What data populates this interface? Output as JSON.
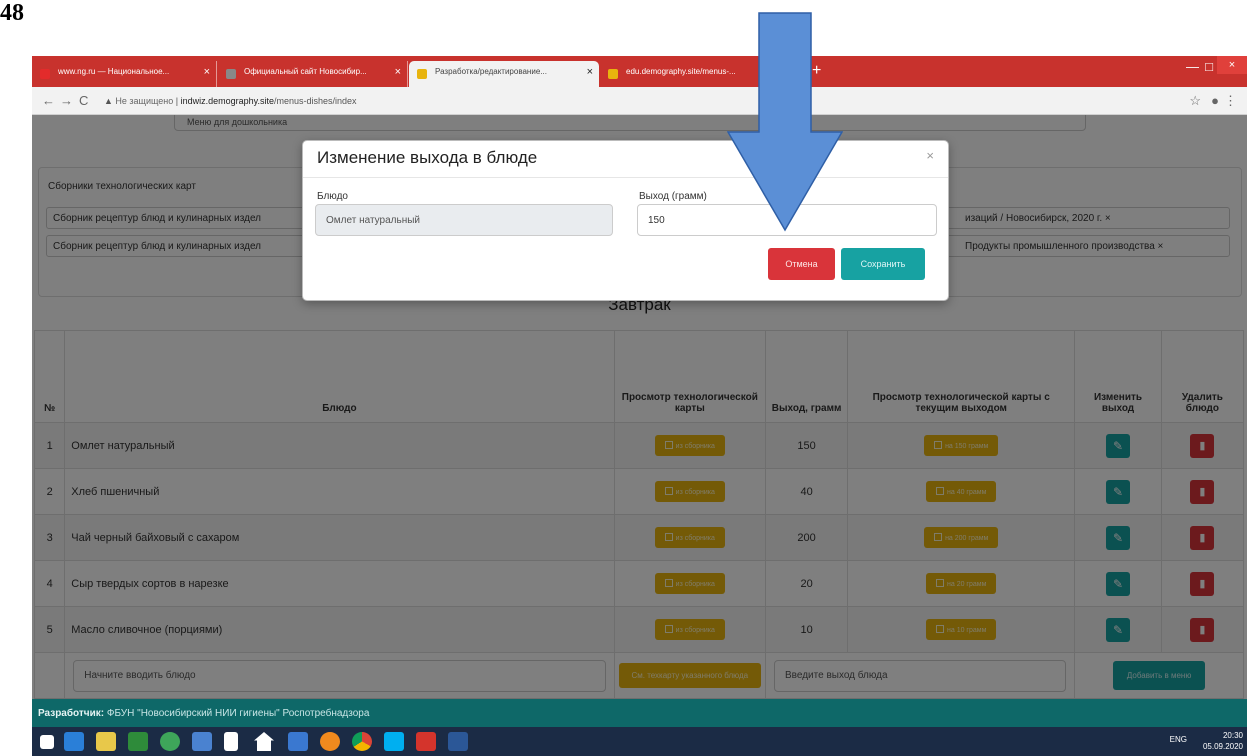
{
  "figure_label": "48",
  "browser": {
    "tabs": [
      {
        "title": "www.ng.ru — Национальное...",
        "favicon_color": "#e32b2b",
        "active": false
      },
      {
        "title": "Официальный сайт Новосибир...",
        "favicon_color": "#888888",
        "active": false
      },
      {
        "title": "Разработка/редактирование...",
        "favicon_color": "#e8b40e",
        "active": true
      },
      {
        "title": "edu.demography.site/menus-...",
        "favicon_color": "#e8b40e",
        "active": false
      }
    ],
    "new_tab": "+",
    "nav": {
      "back": "←",
      "forward": "→",
      "reload": "C"
    },
    "url_warning": "Не защищено",
    "url_host": "indwiz.demography.site",
    "url_path": "/menus-dishes/index",
    "window": {
      "minimize": "—",
      "maximize": "□",
      "close": "×"
    }
  },
  "page": {
    "menu_select": "Меню для дошкольника",
    "collections_label": "Сборники технологических карт",
    "collection_tags": [
      {
        "left": "Сборник рецептур блюд и кулинарных издел",
        "right": "изаций / Новосибирск, 2020 г. ×"
      },
      {
        "left": "Сборник рецептур блюд и кулинарных издел",
        "right": "Продукты промышленного производства ×"
      }
    ],
    "section_title": "Завтрак",
    "table": {
      "headers": {
        "num": "№",
        "dish": "Блюдо",
        "view_card": "Просмотр технологической карты",
        "yield": "Выход, грамм",
        "view_card_yield": "Просмотр технологической карты с текущим выходом",
        "edit": "Изменить выход",
        "delete": "Удалить блюдо"
      },
      "rows": [
        {
          "n": "1",
          "dish": "Омлет натуральный",
          "card_btn": "из сборника",
          "yield": "150",
          "yield_btn": "на 150 грамм"
        },
        {
          "n": "2",
          "dish": "Хлеб пшеничный",
          "card_btn": "из сборника",
          "yield": "40",
          "yield_btn": "на 40 грамм"
        },
        {
          "n": "3",
          "dish": "Чай черный байховый с сахаром",
          "card_btn": "из сборника",
          "yield": "200",
          "yield_btn": "на 200 грамм"
        },
        {
          "n": "4",
          "dish": "Сыр твердых сортов в нарезке",
          "card_btn": "из сборника",
          "yield": "20",
          "yield_btn": "на 20 грамм"
        },
        {
          "n": "5",
          "dish": "Масло сливочное (порциями)",
          "card_btn": "из сборника",
          "yield": "10",
          "yield_btn": "на 10 грамм"
        }
      ],
      "add_row": {
        "dish_placeholder": "Начните вводить блюдо",
        "card_btn": "См. техкарту указанного блюда",
        "yield_placeholder": "Введите выход блюда",
        "add_btn": "Добавить в меню"
      }
    },
    "footer": {
      "label": "Разработчик:",
      "text": "ФБУН \"Новосибирский НИИ гигиены\" Роспотребнадзора"
    }
  },
  "modal": {
    "title": "Изменение выхода в блюде",
    "close": "×",
    "dish_label": "Блюдо",
    "dish_value": "Омлет натуральный",
    "yield_label": "Выход (грамм)",
    "yield_value": "150",
    "cancel_label": "Отмена",
    "save_label": "Сохранить"
  },
  "colors": {
    "teal": "#17a2a2",
    "yellow": "#e8b40e",
    "red": "#d9343a",
    "arrow": "#5b8fd6"
  },
  "taskbar": {
    "icons": [
      "windows-start-icon",
      "ie-icon",
      "explorer-icon",
      "office-icon",
      "utorrent-icon",
      "taskview-icon",
      "file-icon",
      "home-icon",
      "mail-icon",
      "avast-icon",
      "chrome-icon",
      "skype-icon",
      "acrobat-icon",
      "word-icon"
    ],
    "tray": "ENG",
    "time": "20:30",
    "date": "05.09.2020"
  }
}
